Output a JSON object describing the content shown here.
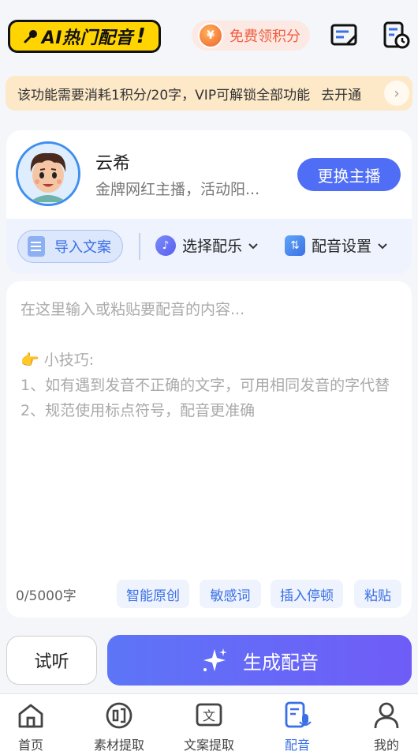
{
  "header": {
    "logo_text": "AI热门配音",
    "free_points_label": "免费领积分",
    "colors": {
      "logo_bg": "#ffd400",
      "accent": "#4f6df5",
      "free_text": "#ef5d3f"
    },
    "icons": [
      "microphone-icon",
      "coin-icon",
      "edit-list-icon",
      "history-clock-icon"
    ]
  },
  "notice": {
    "text": "该功能需要消耗1积分/20字，VIP可解锁全部功能",
    "link_label": "去开通"
  },
  "host": {
    "name": "云希",
    "description": "金牌网红主播，活动阳...",
    "change_label": "更换主播"
  },
  "toolbar": {
    "import_label": "导入文案",
    "music_label": "选择配乐",
    "settings_label": "配音设置"
  },
  "editor": {
    "placeholder": "在这里输入或粘贴要配音的内容...",
    "tip_title": "👉 小技巧:",
    "tip_1": "1、如有遇到发音不正确的文字，可用相同发音的字代替",
    "tip_2": "2、规范使用标点符号，配音更准确",
    "char_count": "0/5000字",
    "chips": [
      "智能原创",
      "敏感词",
      "插入停顿",
      "粘贴"
    ]
  },
  "actions": {
    "try_label": "试听",
    "generate_label": "生成配音"
  },
  "nav": {
    "items": [
      {
        "label": "首页",
        "icon": "home-icon"
      },
      {
        "label": "素材提取",
        "icon": "extract-icon"
      },
      {
        "label": "文案提取",
        "icon": "text-extract-icon"
      },
      {
        "label": "配音",
        "icon": "dubbing-icon"
      },
      {
        "label": "我的",
        "icon": "user-icon"
      }
    ],
    "active_index": 3
  }
}
